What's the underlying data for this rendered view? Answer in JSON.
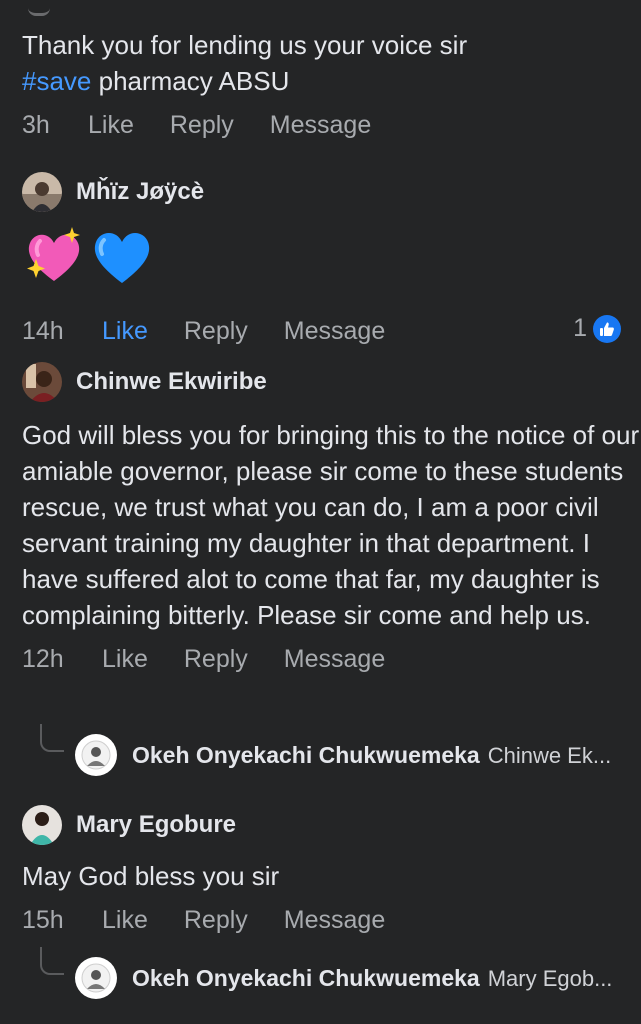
{
  "comments": [
    {
      "text": "Thank you for lending us your voice sir",
      "hashtag": "#save",
      "text_after_hashtag": " pharmacy ABSU",
      "time": "3h",
      "like": "Like",
      "reply": "Reply",
      "message": "Message"
    },
    {
      "author": "Mȟïz Jøÿcè",
      "emojis": [
        "sparkling-heart",
        "blue-heart"
      ],
      "time": "14h",
      "like": "Like",
      "reply": "Reply",
      "message": "Message",
      "reaction_count": "1",
      "liked": true
    },
    {
      "author": "Chinwe Ekwiribe",
      "text": "God will bless you for bringing this to the notice of our amiable governor, please sir come to these students rescue, we trust what you can do, I am a poor civil servant training my daughter in that department. I have suffered alot to come that far, my daughter is complaining bitterly. Please sir come and help us.",
      "time": "12h",
      "like": "Like",
      "reply": "Reply",
      "message": "Message",
      "reply_preview": {
        "author": "Okeh Onyekachi Chukwuemeka",
        "snippet": "Chinwe Ek..."
      }
    },
    {
      "author": "Mary Egobure",
      "text": "May God bless you sir",
      "time": "15h",
      "like": "Like",
      "reply": "Reply",
      "message": "Message",
      "reply_preview": {
        "author": "Okeh Onyekachi Chukwuemeka",
        "snippet": "Mary Egob..."
      }
    }
  ],
  "colors": {
    "background": "#242526",
    "text": "#e4e6eb",
    "secondary": "#a8abaf",
    "accent": "#4599ff",
    "like_badge": "#1877f2"
  }
}
